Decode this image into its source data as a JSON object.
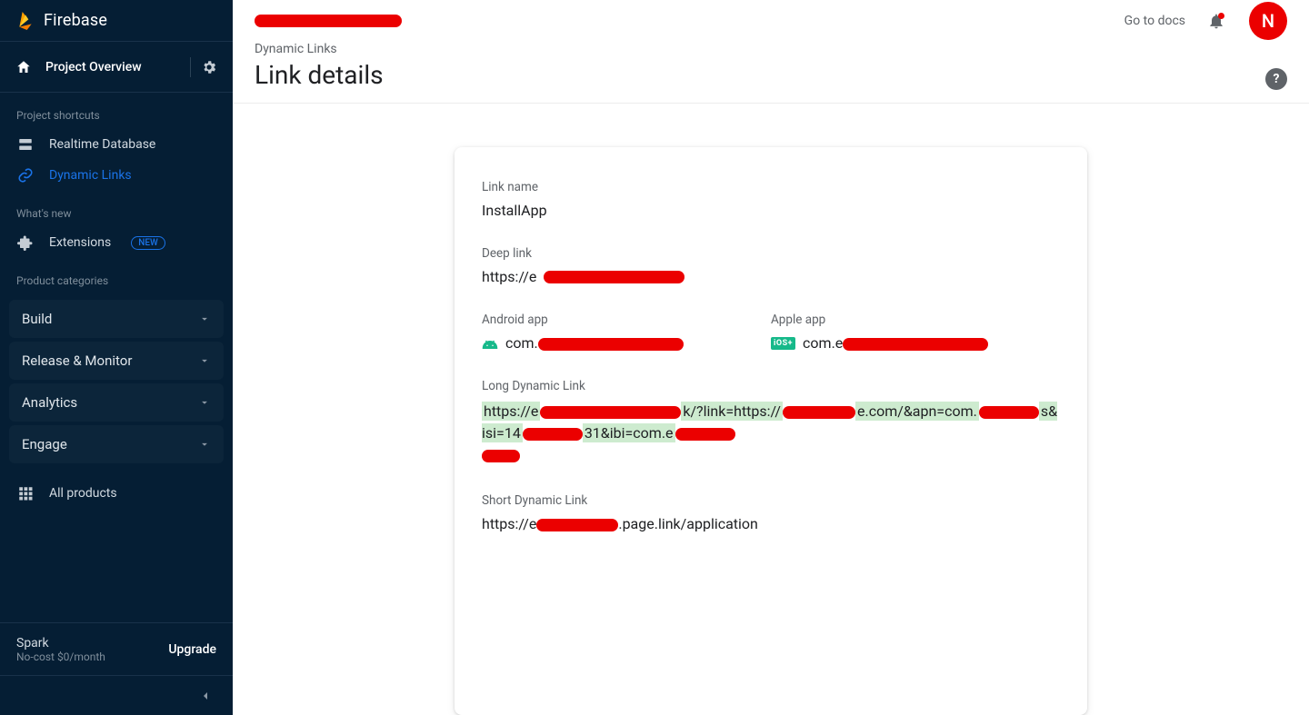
{
  "brand": "Firebase",
  "sidebar": {
    "overview": "Project Overview",
    "sections": {
      "shortcuts": "Project shortcuts",
      "whatsnew": "What's new",
      "categories": "Product categories"
    },
    "shortcuts": [
      {
        "label": "Realtime Database"
      },
      {
        "label": "Dynamic Links"
      }
    ],
    "extensions": "Extensions",
    "new_badge": "NEW",
    "categories": [
      {
        "label": "Build"
      },
      {
        "label": "Release & Monitor"
      },
      {
        "label": "Analytics"
      },
      {
        "label": "Engage"
      }
    ],
    "all_products": "All products",
    "plan_name": "Spark",
    "plan_sub": "No-cost $0/month",
    "upgrade": "Upgrade"
  },
  "topbar": {
    "go_to_docs": "Go to docs",
    "avatar_letter": "N"
  },
  "page": {
    "crumb": "Dynamic Links",
    "title": "Link details"
  },
  "details": {
    "link_name_label": "Link name",
    "link_name_value": "InstallApp",
    "deep_link_label": "Deep link",
    "deep_link_prefix": "https://e",
    "android_label": "Android app",
    "android_prefix": "com.",
    "apple_label": "Apple app",
    "apple_prefix": "com.e",
    "ios_tag": "iOS+",
    "long_label": "Long Dynamic Link",
    "long_link": {
      "seg1": "https://e",
      "seg2": "k/?link=https://",
      "seg3": "e.com/&apn=com.",
      "seg4": "s&isi=14",
      "seg5": "31&ibi=com.e"
    },
    "short_label": "Short Dynamic Link",
    "short_link": {
      "seg1": "https://e",
      "seg2": ".page.link/application"
    }
  }
}
